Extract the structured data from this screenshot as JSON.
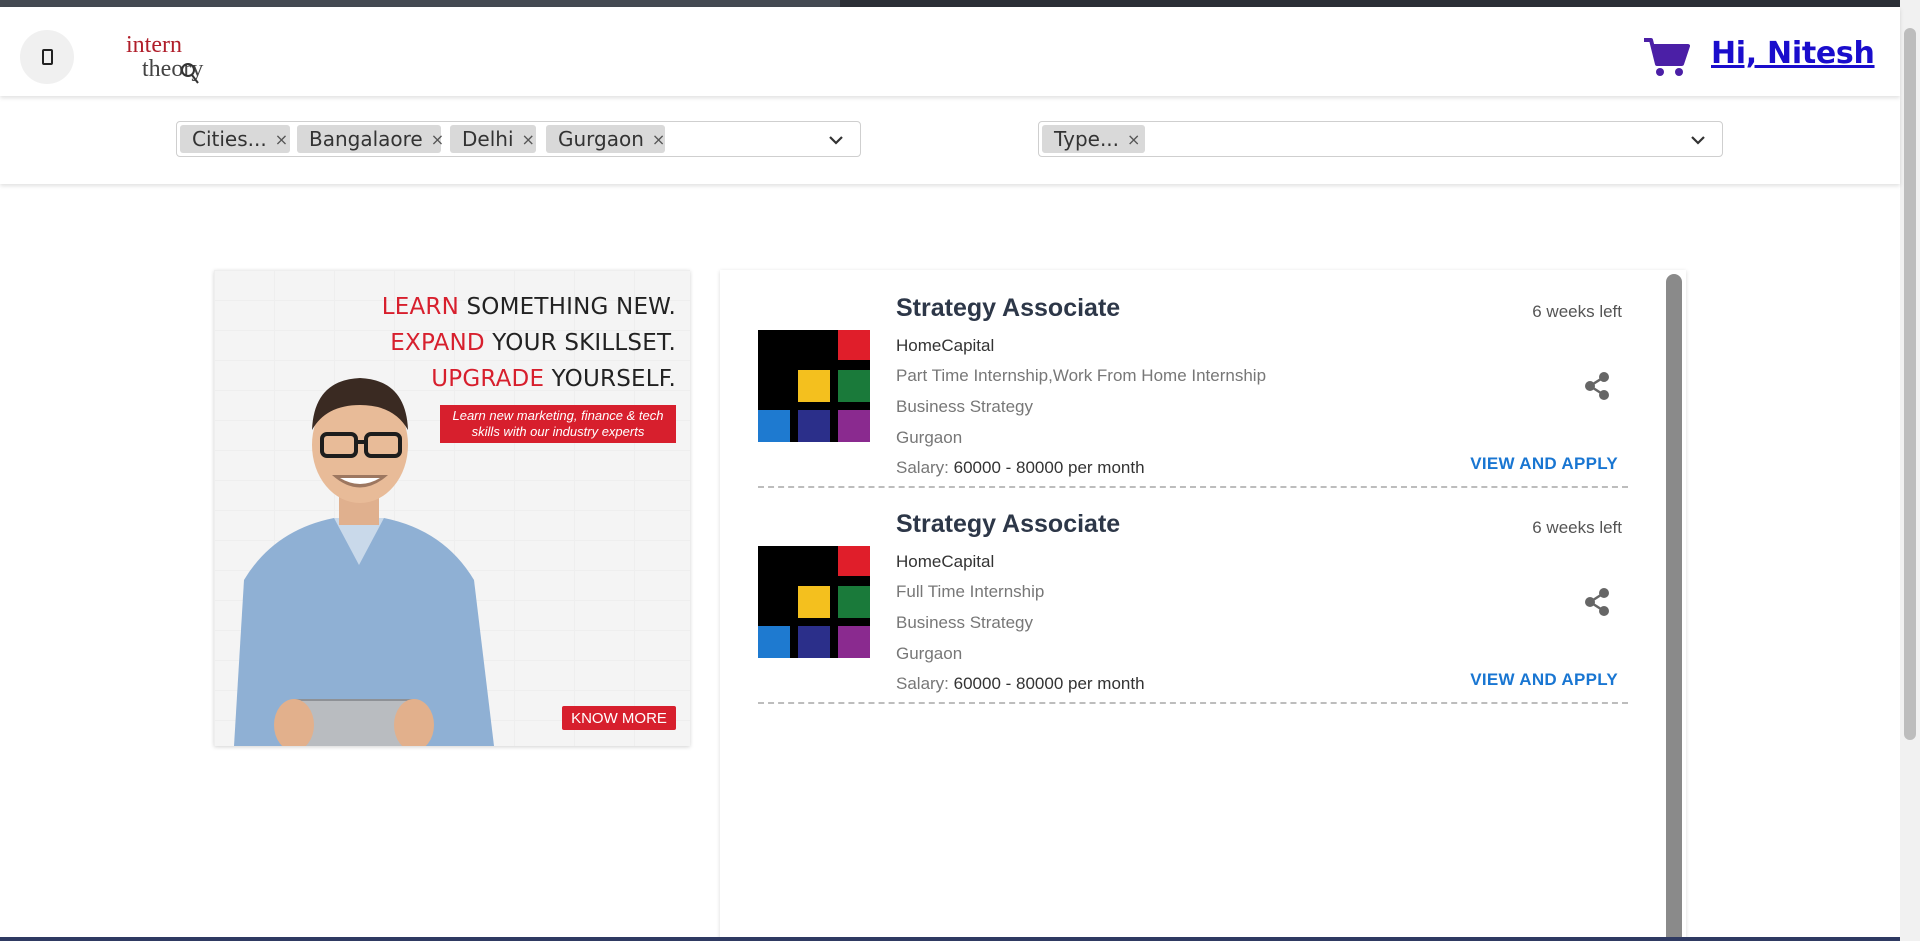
{
  "header": {
    "greeting": "Hi, Nitesh",
    "logo_text_top": "intern",
    "logo_text_bottom": "theory"
  },
  "filters": {
    "cities": {
      "chips": [
        "Cities...",
        "Bangalaore",
        "Delhi",
        "Gurgaon"
      ]
    },
    "type": {
      "chips": [
        "Type..."
      ]
    },
    "remove_glyph": "×"
  },
  "ad": {
    "line1_red": "LEARN",
    "line1_rest": " SOMETHING NEW.",
    "line2_red": "EXPAND",
    "line2_rest": " YOUR SKILLSET.",
    "line3_red": "UPGRADE",
    "line3_rest": " YOURSELF.",
    "tagline": "Learn new marketing, finance & tech skills with our industry experts",
    "cta": "KNOW MORE"
  },
  "jobs": [
    {
      "title": "Strategy Associate",
      "company": "HomeCapital",
      "type": "Part Time Internship,Work From Home Internship",
      "category": "Business Strategy",
      "location": "Gurgaon",
      "salary_label": "Salary: ",
      "salary_value": "60000 - 80000 per month",
      "time_left": "6 weeks left",
      "apply_label": "VIEW AND APPLY"
    },
    {
      "title": "Strategy Associate",
      "company": "HomeCapital",
      "type": "Full Time Internship",
      "category": "Business Strategy",
      "location": "Gurgaon",
      "salary_label": "Salary: ",
      "salary_value": "60000 - 80000 per month",
      "time_left": "6 weeks left",
      "apply_label": "VIEW AND APPLY"
    }
  ],
  "colors": {
    "accent_red": "#d71f2d",
    "link_blue": "#1976d2",
    "greeting_blue": "#1a0dcc",
    "cart_purple": "#4b1fa6"
  },
  "icons": [
    "menu-icon",
    "cart-icon",
    "close-icon",
    "chevron-down-icon",
    "share-icon",
    "company-logo"
  ]
}
